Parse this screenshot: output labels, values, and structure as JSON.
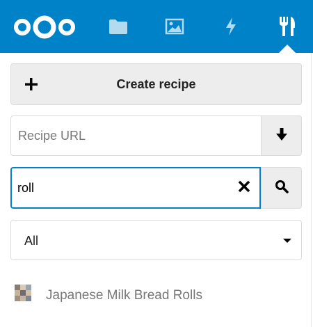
{
  "app": {
    "brand_color": "#0082c9",
    "logo_icon": "nextcloud-logo-icon"
  },
  "nav": {
    "items": [
      {
        "name": "files",
        "icon": "folder-icon",
        "active": false
      },
      {
        "name": "photos",
        "icon": "image-icon",
        "active": false
      },
      {
        "name": "activity",
        "icon": "lightning-icon",
        "active": false
      },
      {
        "name": "cookbook",
        "icon": "fork-knife-icon",
        "active": true
      }
    ]
  },
  "sidebar": {
    "create_button": {
      "icon": "plus-icon",
      "label": "Create recipe"
    },
    "url_import": {
      "placeholder": "Recipe URL",
      "value": "",
      "button_icon": "download-arrow-icon"
    },
    "search": {
      "value": "roll",
      "clear_icon": "close-icon",
      "button_icon": "search-icon",
      "focus_color": "#0082c9"
    },
    "category": {
      "selected": "All"
    },
    "recipes": [
      {
        "title": "Japanese Milk Bread Rolls",
        "thumb": "recipe-thumbnail"
      }
    ]
  }
}
